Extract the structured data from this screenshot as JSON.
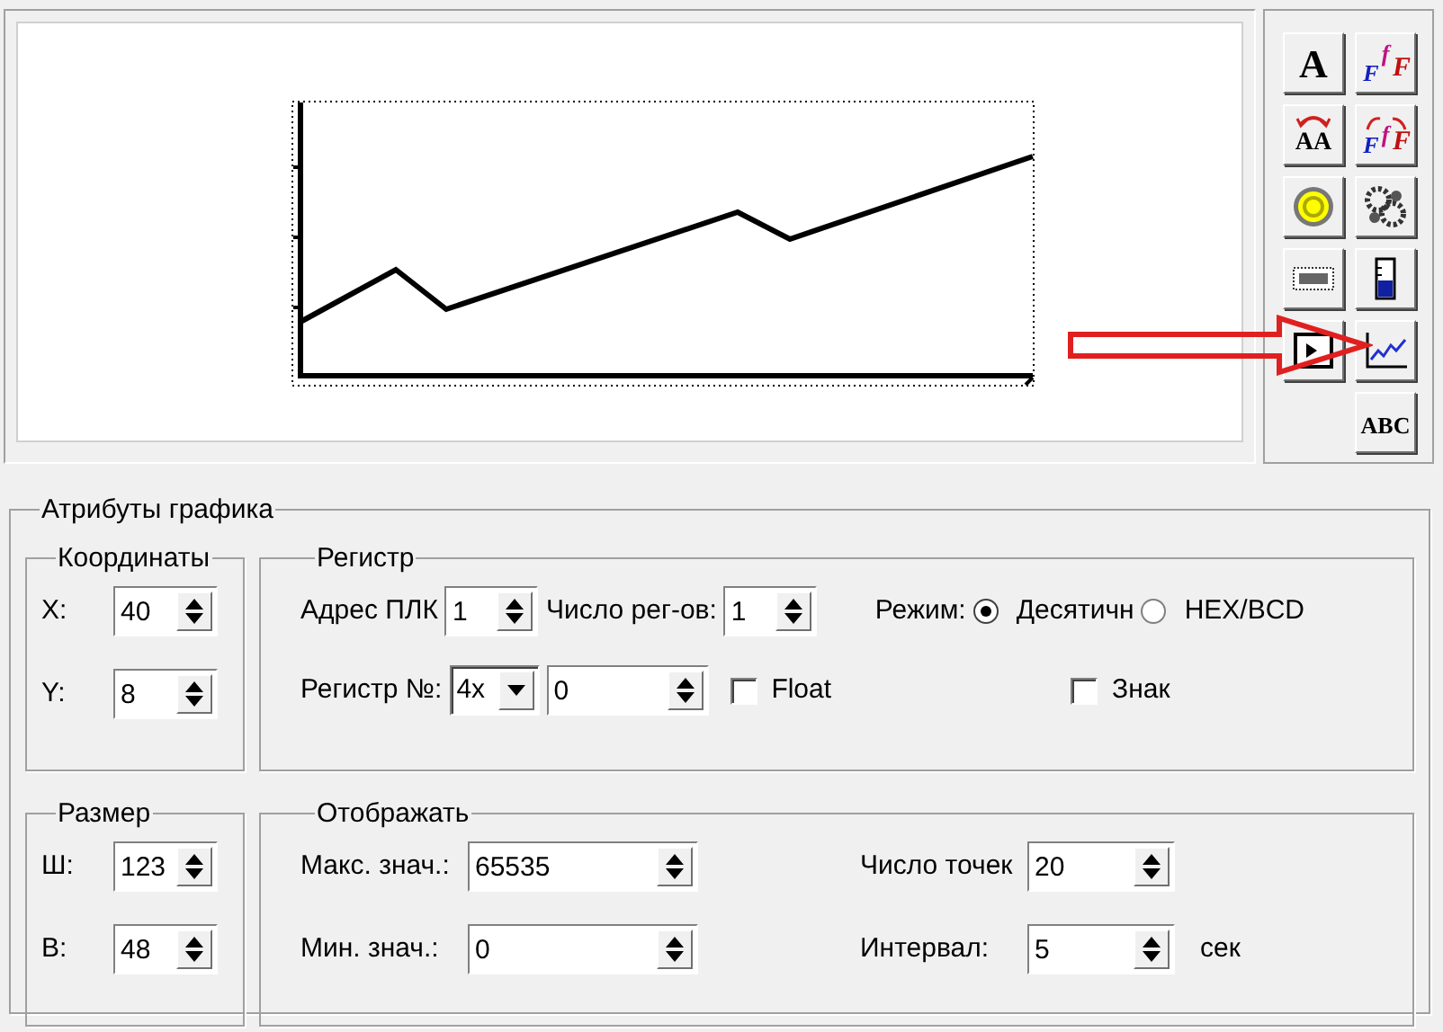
{
  "toolbar": [
    {
      "kind": "letter",
      "label": "A"
    },
    {
      "kind": "font",
      "label": "FfF"
    },
    {
      "kind": "swap",
      "label": "AA"
    },
    {
      "kind": "font-swap",
      "label": "FfF"
    },
    {
      "kind": "lamp"
    },
    {
      "kind": "gears"
    },
    {
      "kind": "display"
    },
    {
      "kind": "tank"
    },
    {
      "kind": "window"
    },
    {
      "kind": "chart"
    },
    {
      "kind": "empty"
    },
    {
      "kind": "letter-small",
      "label": "ABC"
    }
  ],
  "attributes": {
    "title": "Атрибуты графика",
    "coordinates": {
      "title": "Координаты",
      "fields": [
        {
          "label": "X:",
          "value": "40"
        },
        {
          "label": "Y:",
          "value": "8"
        }
      ]
    },
    "register": {
      "title": "Регистр",
      "plc_address": {
        "label": "Адрес ПЛК",
        "value": "1"
      },
      "register_count": {
        "label": "Число рег-ов:",
        "value": "1"
      },
      "mode": {
        "label": "Режим:",
        "options": [
          {
            "label": "Десятичн",
            "selected": true
          },
          {
            "label": "HEX/BCD",
            "selected": false
          }
        ]
      },
      "register_no": {
        "label": "Регистр №:",
        "type": "4x",
        "value": "0"
      },
      "float": {
        "label": "Float",
        "checked": false
      },
      "sign": {
        "label": "Знак",
        "checked": false
      }
    },
    "size": {
      "title": "Размер",
      "fields": [
        {
          "label": "Ш:",
          "value": "123"
        },
        {
          "label": "В:",
          "value": "48"
        }
      ]
    },
    "display": {
      "title": "Отображать",
      "max": {
        "label": "Макс. знач.:",
        "value": "65535"
      },
      "min": {
        "label": "Мин. знач.:",
        "value": "0"
      },
      "points": {
        "label": "Число точек",
        "value": "20"
      },
      "interval": {
        "label": "Интервал:",
        "value": "5",
        "unit": "сек"
      }
    }
  }
}
